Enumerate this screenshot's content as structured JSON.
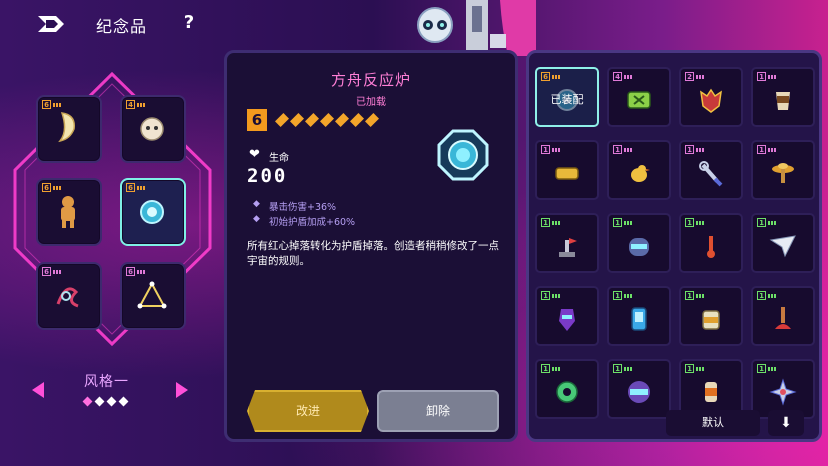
{
  "header": {
    "title": "纪念品",
    "help": "?"
  },
  "style_selector": {
    "label": "风格一",
    "page_count": 4,
    "active_index": 0
  },
  "slots": [
    {
      "grade": "6",
      "icon": "fang-icon",
      "active": false
    },
    {
      "grade": "4",
      "icon": "mask-icon",
      "active": false
    },
    {
      "grade": "6",
      "icon": "gingerbread-icon",
      "active": false
    },
    {
      "grade": "6",
      "icon": "reactor-icon",
      "active": true
    },
    {
      "grade": "6",
      "icon": "knot-icon",
      "active": false
    },
    {
      "grade": "6",
      "icon": "triangle-icon",
      "active": false
    }
  ],
  "detail": {
    "name": "方舟反应炉",
    "status": "已加载",
    "grade": "6",
    "star_count": 7,
    "stat_label": "生命",
    "stat_value": "200",
    "bonuses": [
      "暴击伤害+36%",
      "初始护盾加成+60%"
    ],
    "description": "所有红心掉落转化为护盾掉落。创造者稍稍修改了一点宇宙的规则。",
    "upgrade_label": "改进",
    "remove_label": "卸除"
  },
  "inventory": {
    "equipped_label": "已装配",
    "default_label": "默认",
    "items": [
      {
        "grade": "6",
        "color": "orange",
        "icon": "reactor-icon",
        "selected": true
      },
      {
        "grade": "4",
        "color": "pink",
        "icon": "console-icon"
      },
      {
        "grade": "2",
        "color": "pink",
        "icon": "demon-mask-icon"
      },
      {
        "grade": "1",
        "color": "pink",
        "icon": "cup-icon"
      },
      {
        "grade": "1",
        "color": "pink",
        "icon": "tape-icon"
      },
      {
        "grade": "1",
        "color": "pink",
        "icon": "bird-icon"
      },
      {
        "grade": "1",
        "color": "pink",
        "icon": "wrench-icon"
      },
      {
        "grade": "1",
        "color": "pink",
        "icon": "lamp-icon"
      },
      {
        "grade": "1",
        "color": "green",
        "icon": "joystick-icon"
      },
      {
        "grade": "1",
        "color": "green",
        "icon": "helmet-icon"
      },
      {
        "grade": "1",
        "color": "green",
        "icon": "pin-icon"
      },
      {
        "grade": "1",
        "color": "green",
        "icon": "paper-plane-icon"
      },
      {
        "grade": "1",
        "color": "green",
        "icon": "knight-icon"
      },
      {
        "grade": "1",
        "color": "green",
        "icon": "phone-icon"
      },
      {
        "grade": "1",
        "color": "green",
        "icon": "jar-icon"
      },
      {
        "grade": "1",
        "color": "green",
        "icon": "plunger-icon"
      },
      {
        "grade": "1",
        "color": "green",
        "icon": "donut-icon"
      },
      {
        "grade": "1",
        "color": "green",
        "icon": "visor-icon"
      },
      {
        "grade": "1",
        "color": "green",
        "icon": "bottle-icon"
      },
      {
        "grade": "1",
        "color": "green",
        "icon": "shuriken-icon"
      }
    ]
  },
  "colors": {
    "accent": "#ff4fd8",
    "teal": "#7ff0e6",
    "gold": "#f3a52a"
  }
}
